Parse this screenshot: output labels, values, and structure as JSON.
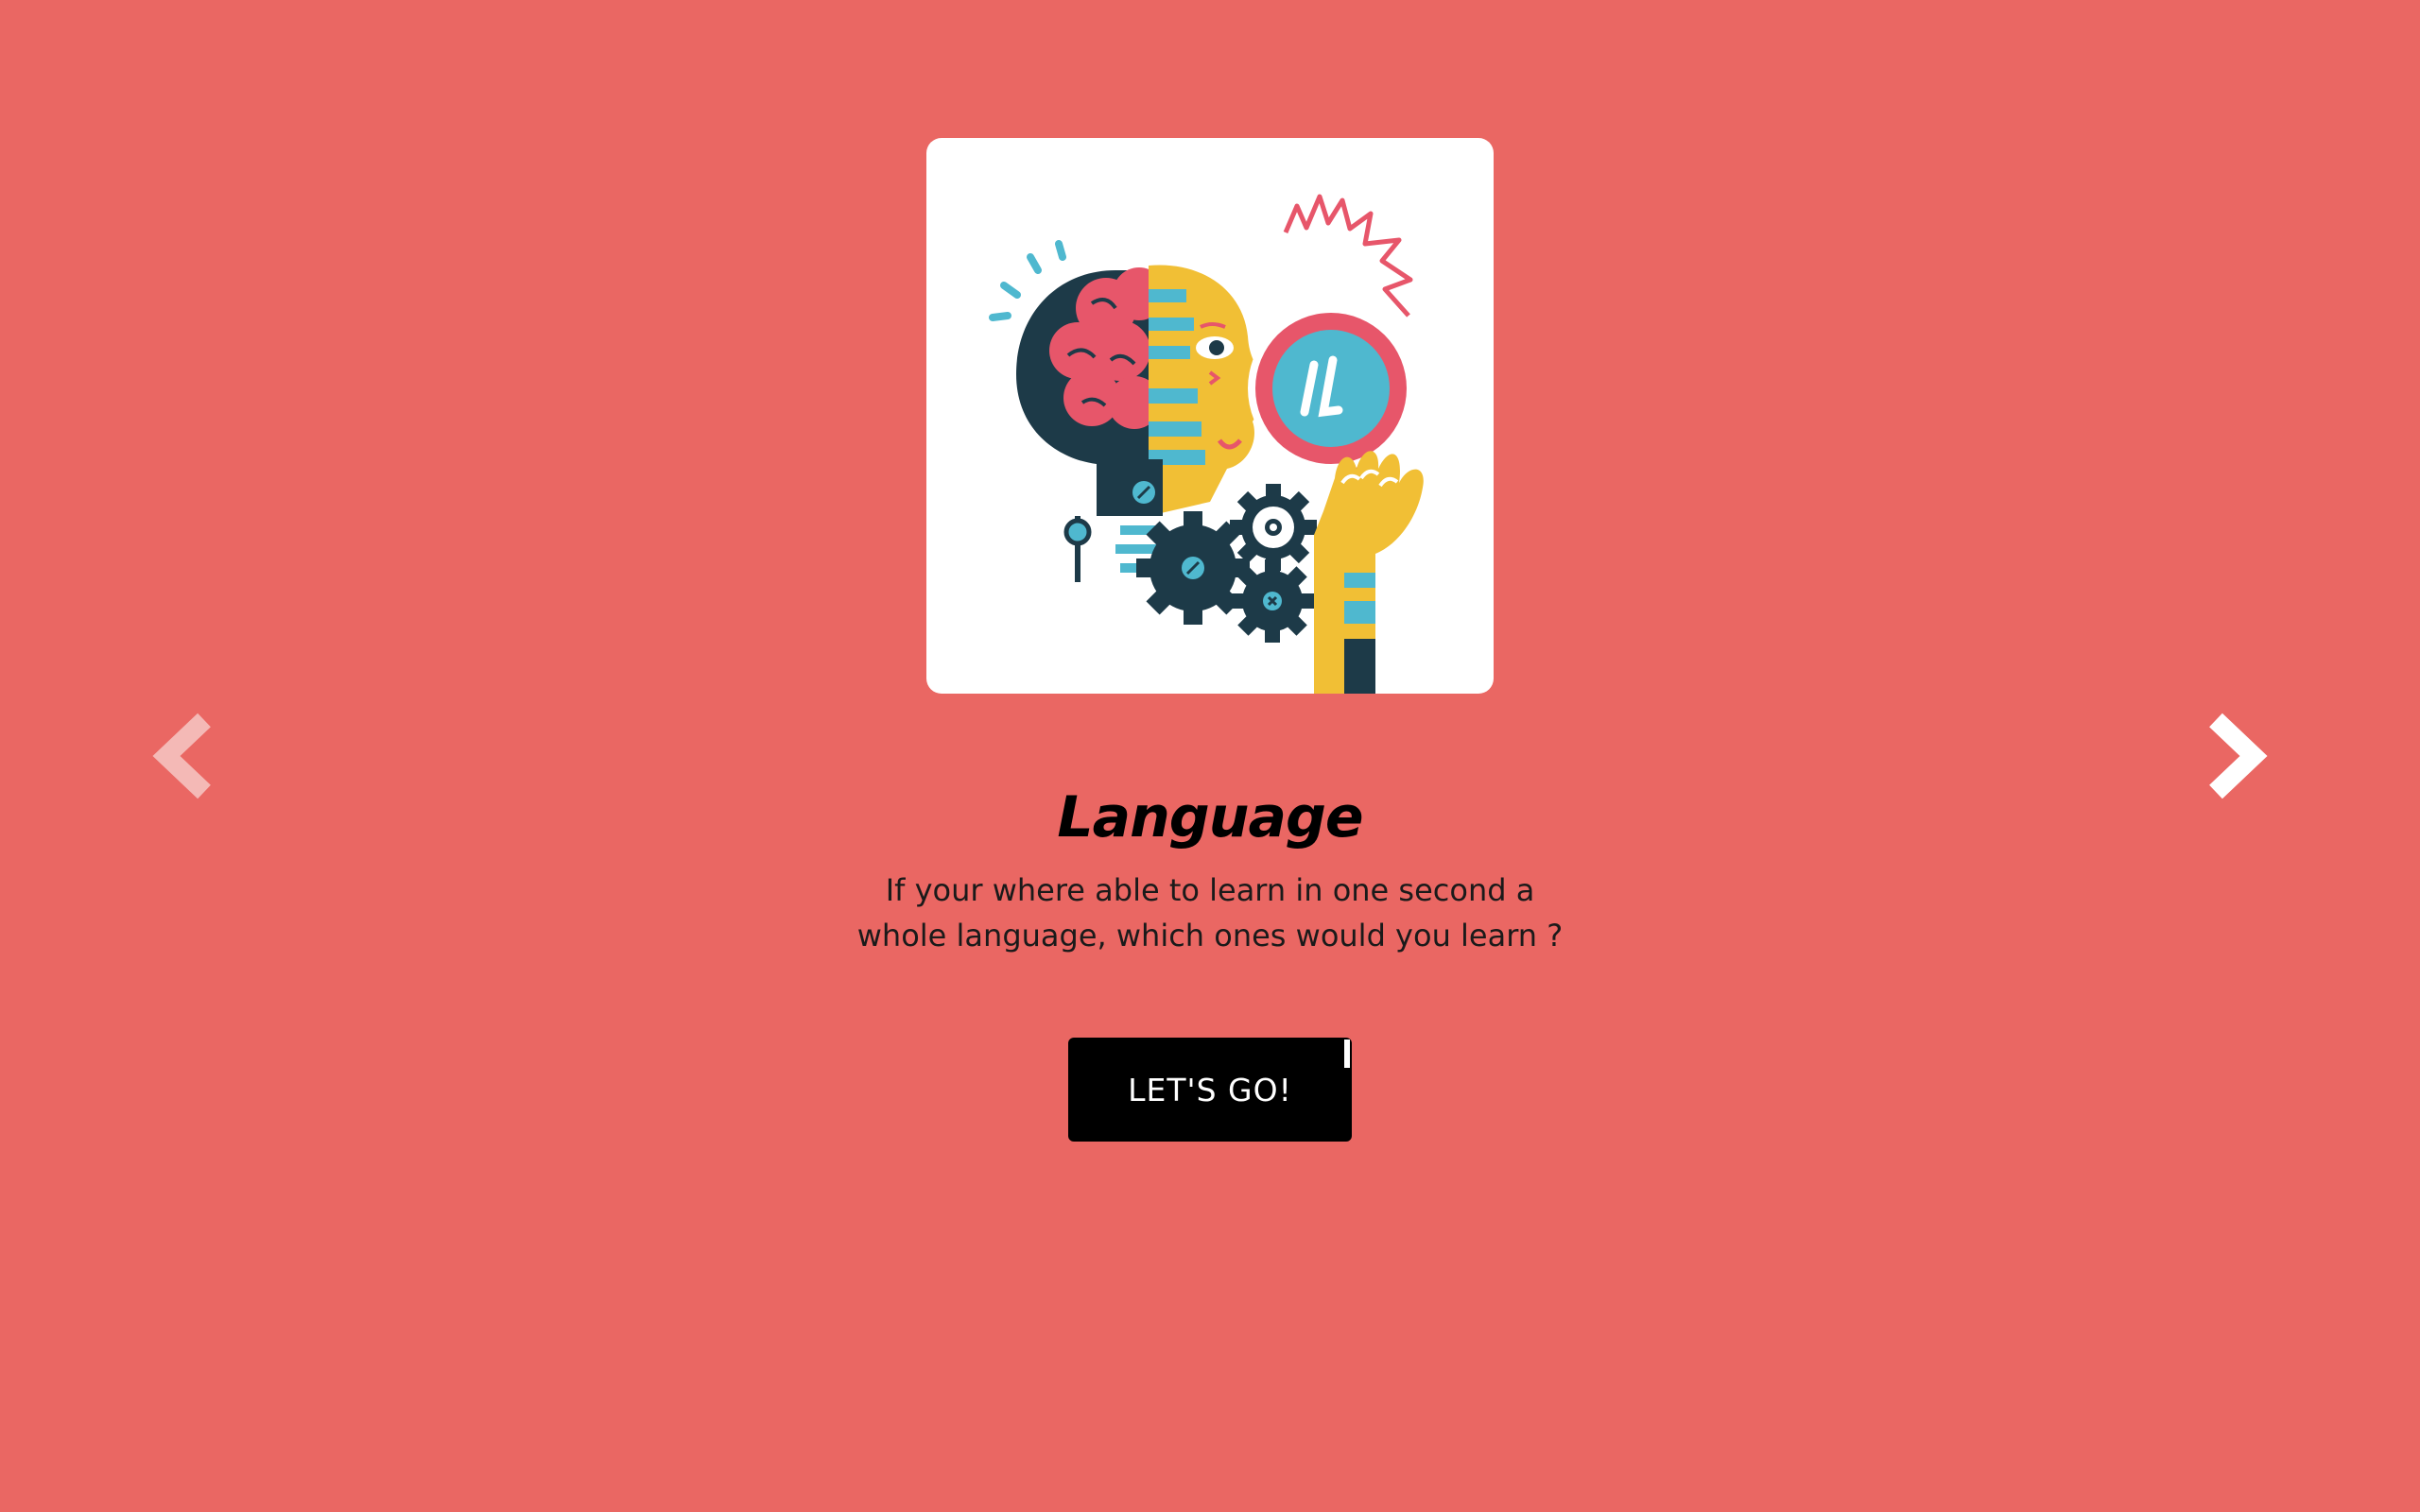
{
  "card": {
    "title": "Language",
    "description_line1": "If your where able to learn in one second a",
    "description_line2": "whole language, which ones would you learn ?",
    "cta_label": "LET'S GO!",
    "illustration_icon": "ai-brain-head-illustration"
  },
  "navigation": {
    "prev_icon": "chevron-left-icon",
    "next_icon": "chevron-right-icon"
  },
  "colors": {
    "background": "#ea6763",
    "card": "#ffffff",
    "button": "#000000",
    "button_text": "#ffffff",
    "arrow": "#ffffff"
  }
}
